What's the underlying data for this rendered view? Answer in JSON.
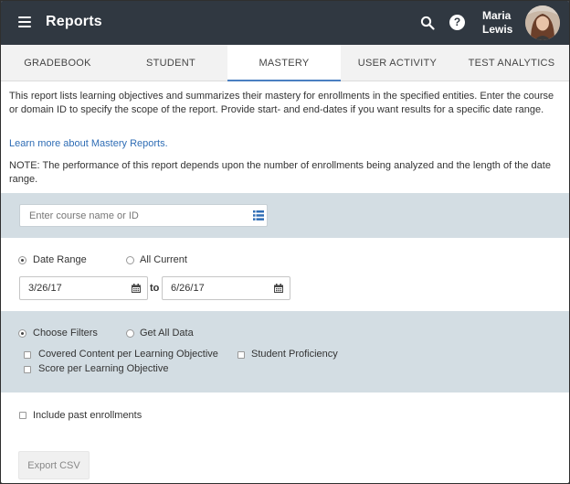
{
  "header": {
    "title": "Reports",
    "user_name_line1": "Maria",
    "user_name_line2": "Lewis",
    "help_glyph": "?",
    "bg_color": "#303841"
  },
  "tabs": [
    {
      "label": "GRADEBOOK",
      "active": false
    },
    {
      "label": "STUDENT",
      "active": false
    },
    {
      "label": "MASTERY",
      "active": true
    },
    {
      "label": "USER ACTIVITY",
      "active": false
    },
    {
      "label": "TEST ANALYTICS",
      "active": false
    }
  ],
  "main": {
    "intro": "This report lists learning objectives and summarizes their mastery for enrollments in the specified entities. Enter the course or domain ID to specify the scope of the report. Provide start- and end-dates if you want results for a specific date range.",
    "learn_more": "Learn more about Mastery Reports.",
    "note": "NOTE: The performance of this report depends upon the number of enrollments being analyzed and the length of the date range.",
    "course_input": {
      "placeholder": "Enter course name or ID",
      "value": ""
    },
    "date_mode": {
      "options": [
        "Date Range",
        "All Current"
      ],
      "selected": "Date Range"
    },
    "start_date": "3/26/17",
    "to_label": "to",
    "end_date": "6/26/17",
    "filter_mode": {
      "options": [
        "Choose Filters",
        "Get All Data"
      ],
      "selected": "Choose Filters"
    },
    "filters": [
      {
        "label": "Covered Content per Learning Objective",
        "checked": false
      },
      {
        "label": "Student Proficiency",
        "checked": false
      },
      {
        "label": "Score per Learning Objective",
        "checked": false
      }
    ],
    "include_past": {
      "label": "Include past enrollments",
      "checked": false
    },
    "export_button": "Export CSV"
  },
  "colors": {
    "accent": "#4a7fc1",
    "link": "#2f6db5",
    "panel": "#d3dde3",
    "tab_bar": "#f2f2f2"
  },
  "icons": [
    "menu-icon",
    "search-icon",
    "help-icon",
    "list-icon",
    "calendar-icon"
  ]
}
